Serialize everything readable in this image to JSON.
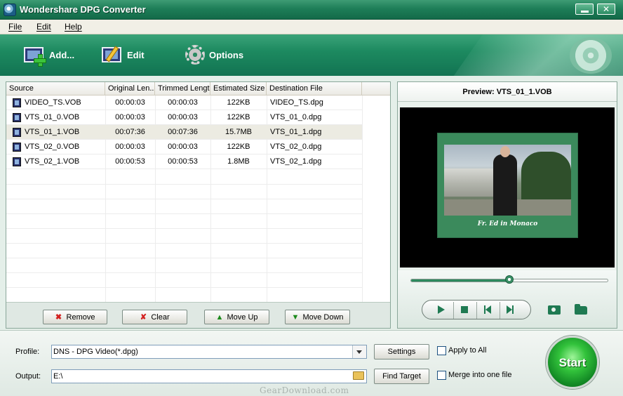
{
  "window": {
    "title": "Wondershare DPG Converter",
    "minimize_label": "",
    "close_label": "✕"
  },
  "menu": [
    "File",
    "Edit",
    "Help"
  ],
  "toolbar": {
    "add_label": "Add...",
    "edit_label": "Edit",
    "options_label": "Options"
  },
  "table": {
    "columns": [
      "Source",
      "Original Len...",
      "Trimmed Length",
      "Estimated Size",
      "Destination File"
    ],
    "rows": [
      {
        "source": "VIDEO_TS.VOB",
        "original": "00:00:03",
        "trimmed": "00:00:03",
        "size": "122KB",
        "dest": "VIDEO_TS.dpg"
      },
      {
        "source": "VTS_01_0.VOB",
        "original": "00:00:03",
        "trimmed": "00:00:03",
        "size": "122KB",
        "dest": "VTS_01_0.dpg"
      },
      {
        "source": "VTS_01_1.VOB",
        "original": "00:07:36",
        "trimmed": "00:07:36",
        "size": "15.7MB",
        "dest": "VTS_01_1.dpg"
      },
      {
        "source": "VTS_02_0.VOB",
        "original": "00:00:03",
        "trimmed": "00:00:03",
        "size": "122KB",
        "dest": "VTS_02_0.dpg"
      },
      {
        "source": "VTS_02_1.VOB",
        "original": "00:00:53",
        "trimmed": "00:00:53",
        "size": "1.8MB",
        "dest": "VTS_02_1.dpg"
      }
    ],
    "selected_row": 2,
    "buttons": {
      "remove": "Remove",
      "clear": "Clear",
      "move_up": "Move Up",
      "move_down": "Move Down"
    }
  },
  "preview": {
    "title": "Preview: VTS_01_1.VOB",
    "caption": "Fr. Ed in  Monaco",
    "progress_fraction": 0.5
  },
  "bottom": {
    "profile_label": "Profile:",
    "profile_value": "DNS - DPG Video(*.dpg)",
    "output_label": "Output:",
    "output_value": "E:\\",
    "settings_label": "Settings",
    "find_target_label": "Find Target",
    "apply_all_label": "Apply to All",
    "merge_label": "Merge into one file",
    "start_label": "Start",
    "watermark": "GearDownload.com"
  },
  "colors": {
    "accent": "#1d8a60",
    "title_bar": "#1e7e58",
    "selected_row": "#ecebe2"
  }
}
